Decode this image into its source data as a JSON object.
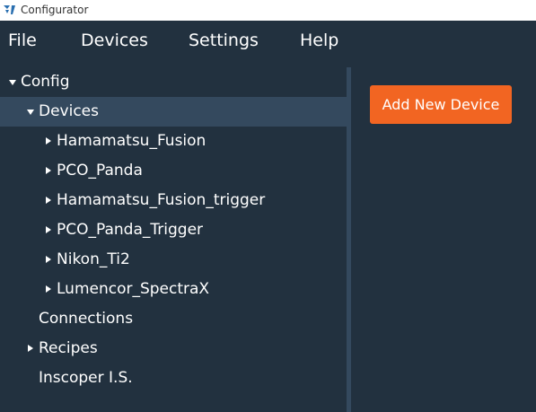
{
  "window": {
    "title": "Configurator"
  },
  "menu": {
    "file": "File",
    "devices": "Devices",
    "settings": "Settings",
    "help": "Help"
  },
  "tree": {
    "config": "Config",
    "devices": "Devices",
    "device_items": [
      "Hamamatsu_Fusion",
      "PCO_Panda",
      "Hamamatsu_Fusion_trigger",
      "PCO_Panda_Trigger",
      "Nikon_Ti2",
      "Lumencor_SpectraX"
    ],
    "connections": "Connections",
    "recipes": "Recipes",
    "inscoper": "Inscoper I.S."
  },
  "actions": {
    "add_device": "Add New Device"
  },
  "colors": {
    "background": "#22313f",
    "selected": "#34495e",
    "accent": "#f26522"
  }
}
